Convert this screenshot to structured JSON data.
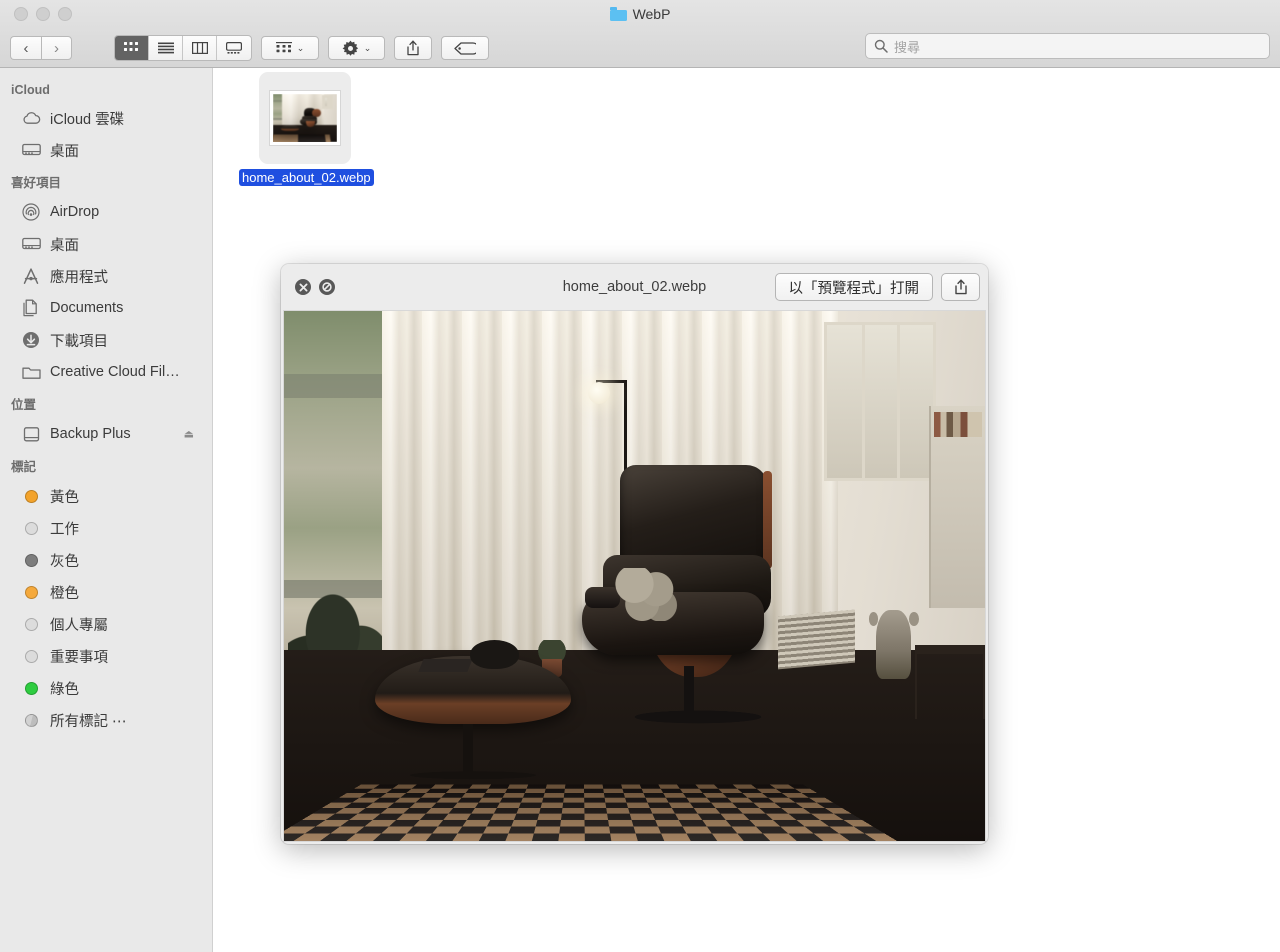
{
  "window": {
    "title": "WebP",
    "folder_icon": "folder-icon",
    "traffic_lights": [
      "close",
      "minimize",
      "zoom"
    ]
  },
  "toolbar": {
    "back_label": "‹",
    "forward_label": "›",
    "view_modes": [
      {
        "name": "icon-view",
        "label": "icon",
        "active": true
      },
      {
        "name": "list-view",
        "label": "list",
        "active": false
      },
      {
        "name": "column-view",
        "label": "column",
        "active": false
      },
      {
        "name": "gallery-view",
        "label": "gallery",
        "active": false
      }
    ],
    "group_button": "arrange-icon",
    "action_button": "gear-icon",
    "share_button": "share-icon",
    "tag_button": "tag-icon",
    "chevron": "⌄"
  },
  "search": {
    "placeholder": "搜尋",
    "value": "",
    "icon": "search-icon"
  },
  "sidebar": {
    "sections": [
      {
        "header": "iCloud",
        "items": [
          {
            "label": "iCloud 雲碟",
            "icon": "cloud-icon"
          },
          {
            "label": "桌面",
            "icon": "desktop-icon"
          }
        ]
      },
      {
        "header": "喜好項目",
        "items": [
          {
            "label": "AirDrop",
            "icon": "airdrop-icon"
          },
          {
            "label": "桌面",
            "icon": "desktop-icon"
          },
          {
            "label": "應用程式",
            "icon": "applications-icon"
          },
          {
            "label": "Documents",
            "icon": "documents-icon"
          },
          {
            "label": "下載項目",
            "icon": "downloads-icon"
          },
          {
            "label": "Creative Cloud Fil…",
            "icon": "folder-icon"
          }
        ]
      },
      {
        "header": "位置",
        "items": [
          {
            "label": "Backup Plus",
            "icon": "drive-icon",
            "eject": "⏏"
          }
        ]
      },
      {
        "header": "標記",
        "items": [
          {
            "label": "黃色",
            "icon": "tag-dot",
            "color": "#f3a32b"
          },
          {
            "label": "工作",
            "icon": "tag-dot",
            "color": "#dcdcdc"
          },
          {
            "label": "灰色",
            "icon": "tag-dot",
            "color": "#7d7d7d"
          },
          {
            "label": "橙色",
            "icon": "tag-dot",
            "color": "#f5a93c"
          },
          {
            "label": "個人專屬",
            "icon": "tag-dot",
            "color": "#dcdcdc"
          },
          {
            "label": "重要事項",
            "icon": "tag-dot",
            "color": "#dcdcdc"
          },
          {
            "label": "綠色",
            "icon": "tag-dot",
            "color": "#2ecc40"
          },
          {
            "label": "所有標記 ⋯",
            "icon": "tag-dot-all",
            "color": "#cfcfcf"
          }
        ]
      }
    ]
  },
  "content": {
    "files": [
      {
        "name": "home_about_02.webp",
        "selected": true,
        "thumbnail": "living-room-photo"
      }
    ]
  },
  "quicklook": {
    "title": "home_about_02.webp",
    "close_icon": "close-icon",
    "ban_icon": "no-entry-icon",
    "open_with_label": "以「預覽程式」打開",
    "share_icon": "share-icon",
    "image_alt": "living-room-photo"
  },
  "colors": {
    "selection_blue": "#1f4fe0",
    "sidebar_bg": "#e9e9e9",
    "toolbar_bg": "#dcdcdc",
    "tag_yellow": "#f3a32b",
    "tag_gray": "#7d7d7d",
    "tag_orange": "#f5a93c",
    "tag_green": "#2ecc40"
  }
}
